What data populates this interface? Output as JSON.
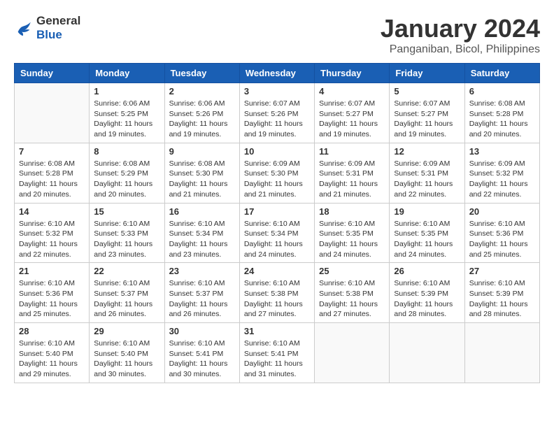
{
  "logo": {
    "line1": "General",
    "line2": "Blue"
  },
  "title": "January 2024",
  "subtitle": "Panganiban, Bicol, Philippines",
  "days_of_week": [
    "Sunday",
    "Monday",
    "Tuesday",
    "Wednesday",
    "Thursday",
    "Friday",
    "Saturday"
  ],
  "weeks": [
    [
      {
        "day": "",
        "sunrise": "",
        "sunset": "",
        "daylight": ""
      },
      {
        "day": "1",
        "sunrise": "Sunrise: 6:06 AM",
        "sunset": "Sunset: 5:25 PM",
        "daylight": "Daylight: 11 hours and 19 minutes."
      },
      {
        "day": "2",
        "sunrise": "Sunrise: 6:06 AM",
        "sunset": "Sunset: 5:26 PM",
        "daylight": "Daylight: 11 hours and 19 minutes."
      },
      {
        "day": "3",
        "sunrise": "Sunrise: 6:07 AM",
        "sunset": "Sunset: 5:26 PM",
        "daylight": "Daylight: 11 hours and 19 minutes."
      },
      {
        "day": "4",
        "sunrise": "Sunrise: 6:07 AM",
        "sunset": "Sunset: 5:27 PM",
        "daylight": "Daylight: 11 hours and 19 minutes."
      },
      {
        "day": "5",
        "sunrise": "Sunrise: 6:07 AM",
        "sunset": "Sunset: 5:27 PM",
        "daylight": "Daylight: 11 hours and 19 minutes."
      },
      {
        "day": "6",
        "sunrise": "Sunrise: 6:08 AM",
        "sunset": "Sunset: 5:28 PM",
        "daylight": "Daylight: 11 hours and 20 minutes."
      }
    ],
    [
      {
        "day": "7",
        "sunrise": "Sunrise: 6:08 AM",
        "sunset": "Sunset: 5:28 PM",
        "daylight": "Daylight: 11 hours and 20 minutes."
      },
      {
        "day": "8",
        "sunrise": "Sunrise: 6:08 AM",
        "sunset": "Sunset: 5:29 PM",
        "daylight": "Daylight: 11 hours and 20 minutes."
      },
      {
        "day": "9",
        "sunrise": "Sunrise: 6:08 AM",
        "sunset": "Sunset: 5:30 PM",
        "daylight": "Daylight: 11 hours and 21 minutes."
      },
      {
        "day": "10",
        "sunrise": "Sunrise: 6:09 AM",
        "sunset": "Sunset: 5:30 PM",
        "daylight": "Daylight: 11 hours and 21 minutes."
      },
      {
        "day": "11",
        "sunrise": "Sunrise: 6:09 AM",
        "sunset": "Sunset: 5:31 PM",
        "daylight": "Daylight: 11 hours and 21 minutes."
      },
      {
        "day": "12",
        "sunrise": "Sunrise: 6:09 AM",
        "sunset": "Sunset: 5:31 PM",
        "daylight": "Daylight: 11 hours and 22 minutes."
      },
      {
        "day": "13",
        "sunrise": "Sunrise: 6:09 AM",
        "sunset": "Sunset: 5:32 PM",
        "daylight": "Daylight: 11 hours and 22 minutes."
      }
    ],
    [
      {
        "day": "14",
        "sunrise": "Sunrise: 6:10 AM",
        "sunset": "Sunset: 5:32 PM",
        "daylight": "Daylight: 11 hours and 22 minutes."
      },
      {
        "day": "15",
        "sunrise": "Sunrise: 6:10 AM",
        "sunset": "Sunset: 5:33 PM",
        "daylight": "Daylight: 11 hours and 23 minutes."
      },
      {
        "day": "16",
        "sunrise": "Sunrise: 6:10 AM",
        "sunset": "Sunset: 5:34 PM",
        "daylight": "Daylight: 11 hours and 23 minutes."
      },
      {
        "day": "17",
        "sunrise": "Sunrise: 6:10 AM",
        "sunset": "Sunset: 5:34 PM",
        "daylight": "Daylight: 11 hours and 24 minutes."
      },
      {
        "day": "18",
        "sunrise": "Sunrise: 6:10 AM",
        "sunset": "Sunset: 5:35 PM",
        "daylight": "Daylight: 11 hours and 24 minutes."
      },
      {
        "day": "19",
        "sunrise": "Sunrise: 6:10 AM",
        "sunset": "Sunset: 5:35 PM",
        "daylight": "Daylight: 11 hours and 24 minutes."
      },
      {
        "day": "20",
        "sunrise": "Sunrise: 6:10 AM",
        "sunset": "Sunset: 5:36 PM",
        "daylight": "Daylight: 11 hours and 25 minutes."
      }
    ],
    [
      {
        "day": "21",
        "sunrise": "Sunrise: 6:10 AM",
        "sunset": "Sunset: 5:36 PM",
        "daylight": "Daylight: 11 hours and 25 minutes."
      },
      {
        "day": "22",
        "sunrise": "Sunrise: 6:10 AM",
        "sunset": "Sunset: 5:37 PM",
        "daylight": "Daylight: 11 hours and 26 minutes."
      },
      {
        "day": "23",
        "sunrise": "Sunrise: 6:10 AM",
        "sunset": "Sunset: 5:37 PM",
        "daylight": "Daylight: 11 hours and 26 minutes."
      },
      {
        "day": "24",
        "sunrise": "Sunrise: 6:10 AM",
        "sunset": "Sunset: 5:38 PM",
        "daylight": "Daylight: 11 hours and 27 minutes."
      },
      {
        "day": "25",
        "sunrise": "Sunrise: 6:10 AM",
        "sunset": "Sunset: 5:38 PM",
        "daylight": "Daylight: 11 hours and 27 minutes."
      },
      {
        "day": "26",
        "sunrise": "Sunrise: 6:10 AM",
        "sunset": "Sunset: 5:39 PM",
        "daylight": "Daylight: 11 hours and 28 minutes."
      },
      {
        "day": "27",
        "sunrise": "Sunrise: 6:10 AM",
        "sunset": "Sunset: 5:39 PM",
        "daylight": "Daylight: 11 hours and 28 minutes."
      }
    ],
    [
      {
        "day": "28",
        "sunrise": "Sunrise: 6:10 AM",
        "sunset": "Sunset: 5:40 PM",
        "daylight": "Daylight: 11 hours and 29 minutes."
      },
      {
        "day": "29",
        "sunrise": "Sunrise: 6:10 AM",
        "sunset": "Sunset: 5:40 PM",
        "daylight": "Daylight: 11 hours and 30 minutes."
      },
      {
        "day": "30",
        "sunrise": "Sunrise: 6:10 AM",
        "sunset": "Sunset: 5:41 PM",
        "daylight": "Daylight: 11 hours and 30 minutes."
      },
      {
        "day": "31",
        "sunrise": "Sunrise: 6:10 AM",
        "sunset": "Sunset: 5:41 PM",
        "daylight": "Daylight: 11 hours and 31 minutes."
      },
      {
        "day": "",
        "sunrise": "",
        "sunset": "",
        "daylight": ""
      },
      {
        "day": "",
        "sunrise": "",
        "sunset": "",
        "daylight": ""
      },
      {
        "day": "",
        "sunrise": "",
        "sunset": "",
        "daylight": ""
      }
    ]
  ]
}
